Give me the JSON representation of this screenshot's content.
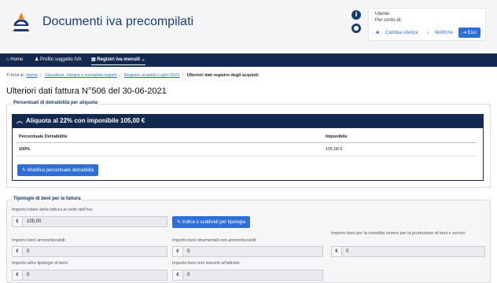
{
  "header": {
    "app_title": "Documenti iva precompilati",
    "info_icon": "info-icon",
    "user_icon": "user-icon",
    "user_label": "Utente:",
    "on_behalf_label": "Per conto di:",
    "change_user_link": "Cambia Utenza",
    "notifications_link": "Notifiche",
    "exit_button": "Esci"
  },
  "nav": {
    "home": "Home",
    "profile": "Profilo soggetto IVA",
    "registers": "Registri iva mensili"
  },
  "breadcrumb": {
    "prefix": "Ti trovi in:",
    "items": [
      "Home",
      "Visualizza, integra e convalida registri",
      "Registro acquisti Luglio 2021"
    ],
    "current": "Ulteriori dati registro degli acquisti"
  },
  "page": {
    "title": "Ulteriori dati fattura N°506 del 30-06-2021"
  },
  "detraibilita": {
    "legend": "Percentuali di detraibilità per aliquota",
    "accordion_title": "Aliquota al 22% con imponibile 105,00 €",
    "columns": [
      "Percentuale Detraibilità",
      "Imponibile"
    ],
    "rows": [
      [
        "100%",
        "105,00 €"
      ]
    ],
    "modify_button": "Modifica percentuale detraibilità"
  },
  "tipologie": {
    "legend": "Tipologie di beni per la fattura",
    "totale_label": "Importo totale della fattura al netto dell'iva:",
    "totale_value": "105,00",
    "indica_button": "Indica o suddividi per tipologia",
    "currency": "€",
    "fields": [
      {
        "label": "Importo beni ammortizzabili:",
        "value": "0"
      },
      {
        "label": "Importo beni strumentali non ammortizzabili:",
        "value": "0"
      },
      {
        "label": "Importo beni per la rivendita ovvero per la produzione di beni e servizi:",
        "value": "0"
      },
      {
        "label": "Importo altre tipologie di beni:",
        "value": "0"
      },
      {
        "label": "Importo beni non inerenti all'attività:",
        "value": "0"
      }
    ]
  },
  "colors": {
    "navy": "#13294f",
    "primary": "#2d6fd6"
  }
}
